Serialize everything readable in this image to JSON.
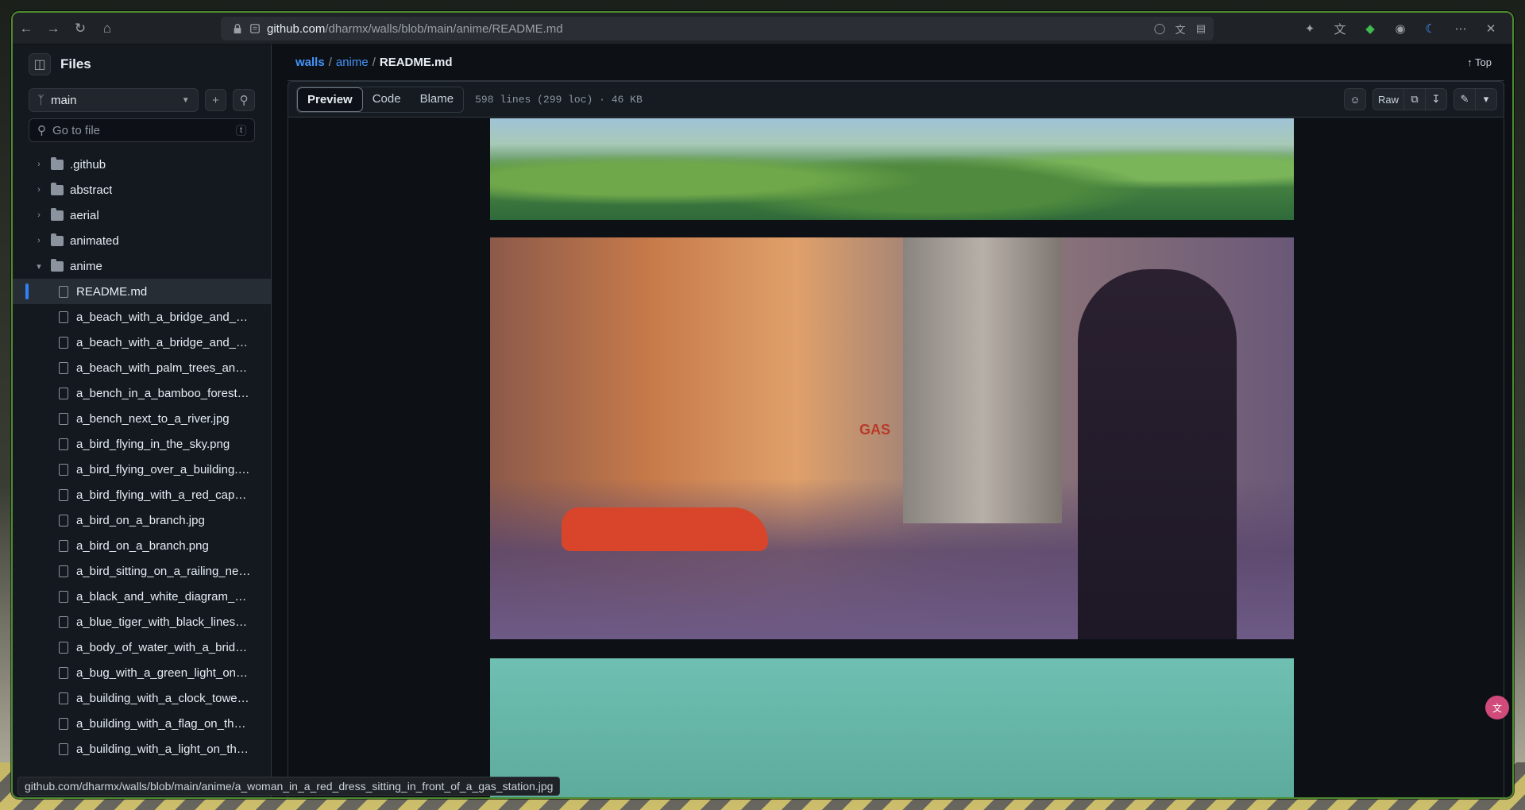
{
  "browser": {
    "url_host": "github.com",
    "url_path": "/dharmx/walls/blob/main/anime/README.md",
    "status_url": "github.com/dharmx/walls/blob/main/anime/a_woman_in_a_red_dress_sitting_in_front_of_a_gas_station.jpg"
  },
  "sidebar": {
    "title": "Files",
    "branch": "main",
    "goto_placeholder": "Go to file",
    "goto_shortcut": "t",
    "folders": [
      ".github",
      "abstract",
      "aerial",
      "animated",
      "anime"
    ],
    "files": [
      "README.md",
      "a_beach_with_a_bridge_and_tre...",
      "a_beach_with_a_bridge_and_tre...",
      "a_beach_with_palm_trees_and_a...",
      "a_bench_in_a_bamboo_forest.png",
      "a_bench_next_to_a_river.jpg",
      "a_bird_flying_in_the_sky.png",
      "a_bird_flying_over_a_building.jp...",
      "a_bird_flying_with_a_red_cape_a...",
      "a_bird_on_a_branch.jpg",
      "a_bird_on_a_branch.png",
      "a_bird_sitting_on_a_railing_next...",
      "a_black_and_white_diagram_of_...",
      "a_blue_tiger_with_black_lines_a...",
      "a_body_of_water_with_a_bridge...",
      "a_bug_with_a_green_light_on_th...",
      "a_building_with_a_clock_tower_...",
      "a_building_with_a_flag_on_the_r...",
      "a_building_with_a_light_on_the_..."
    ]
  },
  "breadcrumb": {
    "repo": "walls",
    "folder": "anime",
    "file": "README.md",
    "top_label": "Top"
  },
  "file_header": {
    "tabs": [
      "Preview",
      "Code",
      "Blame"
    ],
    "info": "598 lines (299 loc) · 46 KB",
    "raw_label": "Raw"
  },
  "image_sign": "GAS"
}
